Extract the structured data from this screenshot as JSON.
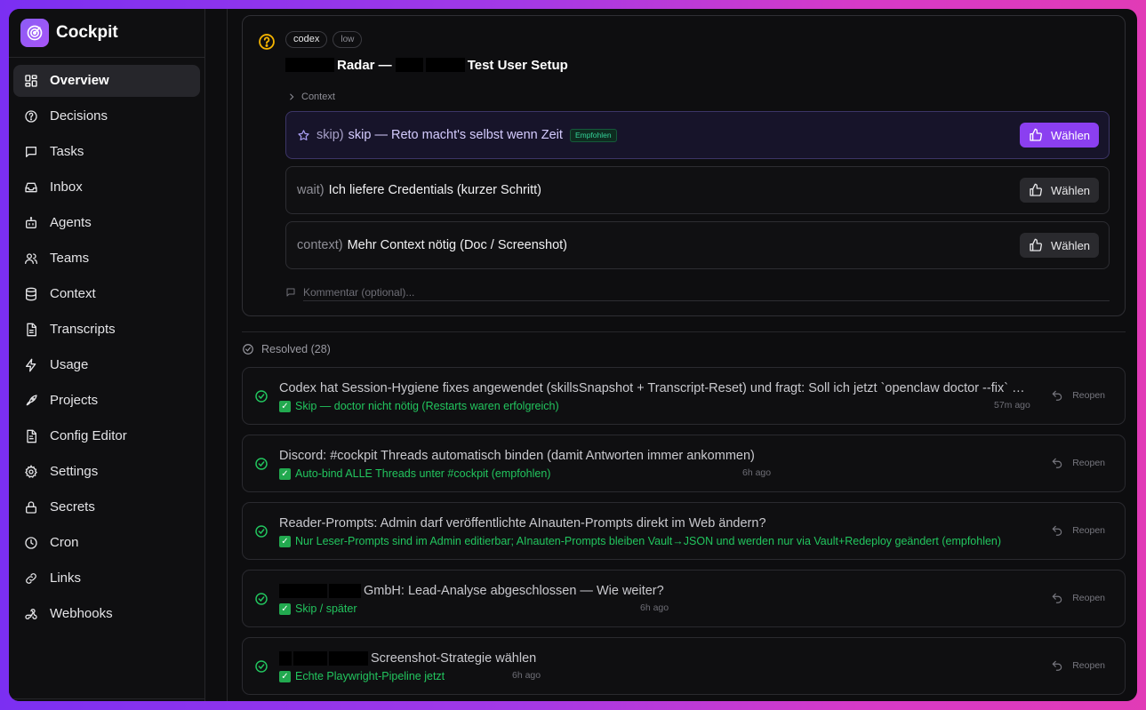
{
  "app": {
    "name": "Cockpit"
  },
  "sidebar": {
    "items": [
      {
        "label": "Overview",
        "icon": "layout-dashboard-icon",
        "active": true
      },
      {
        "label": "Decisions",
        "icon": "help-circle-icon"
      },
      {
        "label": "Tasks",
        "icon": "message-square-icon"
      },
      {
        "label": "Inbox",
        "icon": "inbox-icon"
      },
      {
        "label": "Agents",
        "icon": "bot-icon"
      },
      {
        "label": "Teams",
        "icon": "users-icon"
      },
      {
        "label": "Context",
        "icon": "database-icon"
      },
      {
        "label": "Transcripts",
        "icon": "file-text-icon"
      },
      {
        "label": "Usage",
        "icon": "zap-icon"
      },
      {
        "label": "Projects",
        "icon": "rocket-icon"
      },
      {
        "label": "Config Editor",
        "icon": "file-edit-icon"
      },
      {
        "label": "Settings",
        "icon": "gear-icon"
      },
      {
        "label": "Secrets",
        "icon": "lock-icon"
      },
      {
        "label": "Cron",
        "icon": "clock-icon"
      },
      {
        "label": "Links",
        "icon": "link-icon"
      },
      {
        "label": "Webhooks",
        "icon": "webhook-icon"
      }
    ]
  },
  "decision": {
    "tags": [
      "codex",
      "low"
    ],
    "title_part1": "Radar —",
    "title_part2": "Test User Setup",
    "context_label": "Context",
    "options": [
      {
        "key": "skip)",
        "text": "skip — Reto macht's selbst wenn Zeit",
        "recommended": true,
        "badge": "Empfohlen",
        "button": "Wählen"
      },
      {
        "key": "wait)",
        "text": "Ich liefere Credentials (kurzer Schritt)",
        "recommended": false,
        "button": "Wählen"
      },
      {
        "key": "context)",
        "text": "Mehr Context nötig (Doc / Screenshot)",
        "recommended": false,
        "button": "Wählen"
      }
    ],
    "comment_placeholder": "Kommentar (optional)..."
  },
  "resolved": {
    "header": "Resolved (28)",
    "reopen_label": "Reopen",
    "items": [
      {
        "title": "Codex hat Session-Hygiene fixes angewendet (skillsSnapshot + Transcript-Reset) und fragt: Soll ich jetzt `openclaw doctor --fix` ausführen?",
        "answer": "Skip — doctor nicht nötig (Restarts waren erfolgreich)",
        "time": "57m ago"
      },
      {
        "title": "Discord: #cockpit Threads automatisch binden (damit Antworten immer ankommen)",
        "answer": "Auto-bind ALLE Threads unter #cockpit (empfohlen)",
        "time": "6h ago"
      },
      {
        "title": "Reader-Prompts: Admin darf veröffentlichte AInauten-Prompts direkt im Web ändern?",
        "answer": "Nur Leser-Prompts sind im Admin editierbar; AInauten-Prompts bleiben Vault→JSON und werden nur via Vault+Redeploy geändert (empfohlen)",
        "time": ""
      },
      {
        "title": "GmbH: Lead-Analyse abgeschlossen — Wie weiter?",
        "answer": "Skip / später",
        "time": "6h ago"
      },
      {
        "title": "Screenshot-Strategie wählen",
        "answer": "Echte Playwright-Pipeline jetzt",
        "time": "6h ago"
      }
    ]
  },
  "colors": {
    "accent": "#8b3ff0",
    "success": "#22c55e",
    "warning": "#f5b400"
  }
}
